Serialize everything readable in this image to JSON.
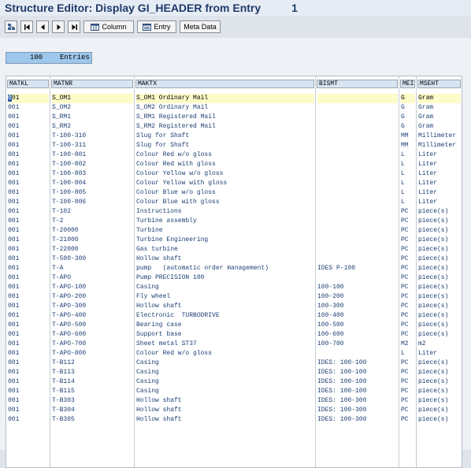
{
  "window": {
    "title": "Structure Editor: Display GI_HEADER from Entry",
    "entry_number": "1"
  },
  "toolbar": {
    "buttons": [
      {
        "icon": "tree-structure-icon",
        "label": ""
      },
      {
        "icon": "first-page-icon",
        "label": ""
      },
      {
        "icon": "previous-page-icon",
        "label": ""
      },
      {
        "icon": "next-page-icon",
        "label": ""
      },
      {
        "icon": "last-page-icon",
        "label": ""
      },
      {
        "icon": "column-icon",
        "label": "Column"
      },
      {
        "icon": "entry-icon",
        "label": "Entry"
      },
      {
        "icon": "",
        "label": "Meta Data"
      }
    ]
  },
  "entries_box": {
    "count": "100",
    "label": "Entries"
  },
  "table": {
    "columns": [
      "MATKL",
      "MATNR",
      "MAKTX",
      "BISMT",
      "MEI",
      "MSEHT"
    ],
    "selected_row": 0,
    "rows": [
      [
        "001",
        "S_OM1",
        "S_OM1 Ordinary Mail",
        "",
        "G",
        "Gram"
      ],
      [
        "001",
        "S_OM2",
        "S_OM2 Ordinary Mail",
        "",
        "G",
        "Gram"
      ],
      [
        "001",
        "S_RM1",
        "S_RM1 Registered Mail",
        "",
        "G",
        "Gram"
      ],
      [
        "001",
        "S_RM2",
        "S_RM2 Registered Mail",
        "",
        "G",
        "Gram"
      ],
      [
        "001",
        "T-100-310",
        "Slug for Shaft",
        "",
        "MM",
        "Millimeter"
      ],
      [
        "001",
        "T-100-311",
        "Slug for Shaft",
        "",
        "MM",
        "Millimeter"
      ],
      [
        "001",
        "T-100-801",
        "Colour Red w/o gloss",
        "",
        "L",
        "Liter"
      ],
      [
        "001",
        "T-100-802",
        "Colour Red with gloss",
        "",
        "L",
        "Liter"
      ],
      [
        "001",
        "T-100-803",
        "Colour Yellow w/o gloss",
        "",
        "L",
        "Liter"
      ],
      [
        "001",
        "T-100-804",
        "Colour Yellow with gloss",
        "",
        "L",
        "Liter"
      ],
      [
        "001",
        "T-100-805",
        "Colour Blue w/o gloss",
        "",
        "L",
        "Liter"
      ],
      [
        "001",
        "T-100-806",
        "Colour Blue with gloss",
        "",
        "L",
        "Liter"
      ],
      [
        "001",
        "T-102",
        "Instructions",
        "",
        "PC",
        "piece(s)"
      ],
      [
        "001",
        "T-2",
        "Turbine assembly",
        "",
        "PC",
        "piece(s)"
      ],
      [
        "001",
        "T-20000",
        "Turbine",
        "",
        "PC",
        "piece(s)"
      ],
      [
        "001",
        "T-21000",
        "Turbine Engineering",
        "",
        "PC",
        "piece(s)"
      ],
      [
        "001",
        "T-22000",
        "Gas turbine",
        "",
        "PC",
        "piece(s)"
      ],
      [
        "001",
        "T-500-300",
        "Hollow shaft",
        "",
        "PC",
        "piece(s)"
      ],
      [
        "001",
        "T-A",
        "pump   (automatic order management)",
        "IDES P-100",
        "PC",
        "piece(s)"
      ],
      [
        "001",
        "T-APO",
        "Pump PRECISION 100",
        "",
        "PC",
        "piece(s)"
      ],
      [
        "001",
        "T-APO-100",
        "Casing",
        "100-100",
        "PC",
        "piece(s)"
      ],
      [
        "001",
        "T-APO-200",
        "Fly wheel",
        "100-200",
        "PC",
        "piece(s)"
      ],
      [
        "001",
        "T-APO-300",
        "Hollow shaft",
        "100-300",
        "PC",
        "piece(s)"
      ],
      [
        "001",
        "T-APO-400",
        "Electronic  TURBODRIVE",
        "100-400",
        "PC",
        "piece(s)"
      ],
      [
        "001",
        "T-APO-500",
        "Bearing case",
        "100-500",
        "PC",
        "piece(s)"
      ],
      [
        "001",
        "T-APO-600",
        "Support base",
        "100-600",
        "PC",
        "piece(s)"
      ],
      [
        "001",
        "T-APO-700",
        "Sheet metal ST37",
        "100-700",
        "M2",
        "m2"
      ],
      [
        "001",
        "T-APO-800",
        "Colour Red w/o gloss",
        "",
        "L",
        "Liter"
      ],
      [
        "001",
        "T-B112",
        "Casing",
        "IDES: 100-100",
        "PC",
        "piece(s)"
      ],
      [
        "001",
        "T-B113",
        "Casing",
        "IDES: 100-100",
        "PC",
        "piece(s)"
      ],
      [
        "001",
        "T-B114",
        "Casing",
        "IDES: 100-100",
        "PC",
        "piece(s)"
      ],
      [
        "001",
        "T-B115",
        "Casing",
        "IDES: 100-100",
        "PC",
        "piece(s)"
      ],
      [
        "001",
        "T-B303",
        "Hollow shaft",
        "IDES: 100-300",
        "PC",
        "piece(s)"
      ],
      [
        "001",
        "T-B304",
        "Hollow shaft",
        "IDES: 100-300",
        "PC",
        "piece(s)"
      ],
      [
        "001",
        "T-B305",
        "Hollow shaft",
        "IDES: 100-300",
        "PC",
        "piece(s)"
      ]
    ]
  },
  "colors": {
    "title_text": "#1f3a6b",
    "cell_text": "#1d3f74",
    "header_bg": "#d8e4f1",
    "selected_row_bg": "#fdfbc7",
    "entries_bg": "#9ec7ec"
  }
}
